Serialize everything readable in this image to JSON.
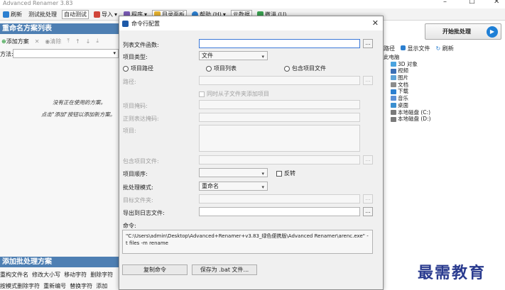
{
  "window": {
    "title": "Advanced Renamer 3.83"
  },
  "toolbar": {
    "items": [
      "刷新",
      "测试批处理",
      "自动测试",
      "导入",
      "程序",
      "目录面板",
      "帮助 (H)",
      "元数据",
      "撤消 (U)"
    ]
  },
  "left": {
    "header": "重命名方案列表",
    "add": "添加方案",
    "clear": "清除",
    "combo_label": "方法:",
    "hint1": "没有正在使用的方案。",
    "hint2": "点击\"添加\"按钮以添加新方案。",
    "bottom_header": "添加批处理方案",
    "methods_row1": [
      "重构文件名",
      "修改大小写",
      "移动字符",
      "删除字符"
    ],
    "methods_row2": [
      "按模式删除字符",
      "重新编号",
      "替换字符",
      "添加"
    ]
  },
  "right": {
    "start": "开始批处理",
    "tb": [
      "路径",
      "显示文件",
      "刷新"
    ],
    "tree_root": "此电脑",
    "tree": [
      "3D 对象",
      "视频",
      "图片",
      "文档",
      "下载",
      "音乐",
      "桌面",
      "本地磁盘 (C:)",
      "本地磁盘 (D:)"
    ]
  },
  "dialog": {
    "title": "命令行配置",
    "list_label": "列表文件函数:",
    "type_label": "项目类型:",
    "type_value": "文件",
    "radio_path": "项目路径",
    "radio_list": "项目列表",
    "radio_inc": "包含项目文件",
    "path_label": "路径:",
    "subfolder": "同时从子文件夹添加项目",
    "mask_label": "项目掩码:",
    "regex_label": "正则表达掩码:",
    "items_label": "项目:",
    "incfile_label": "包含项目文件:",
    "order_label": "项目顺序:",
    "reverse": "反转",
    "batch_label": "批处理模式:",
    "batch_value": "重命名",
    "target_label": "目标文件夹:",
    "log_label": "导出到日志文件:",
    "cmd_label": "命令:",
    "cmd_text": "\"C:\\Users\\admin\\Desktop\\Advanced+Renamer+v3.83_绿色便携版\\Advanced Renamer\\arenc.exe\" -t files -m rename",
    "copy_btn": "复制命令",
    "save_btn": "保存为 .bat 文件...",
    "dots": "..."
  },
  "logo": "最需教育"
}
